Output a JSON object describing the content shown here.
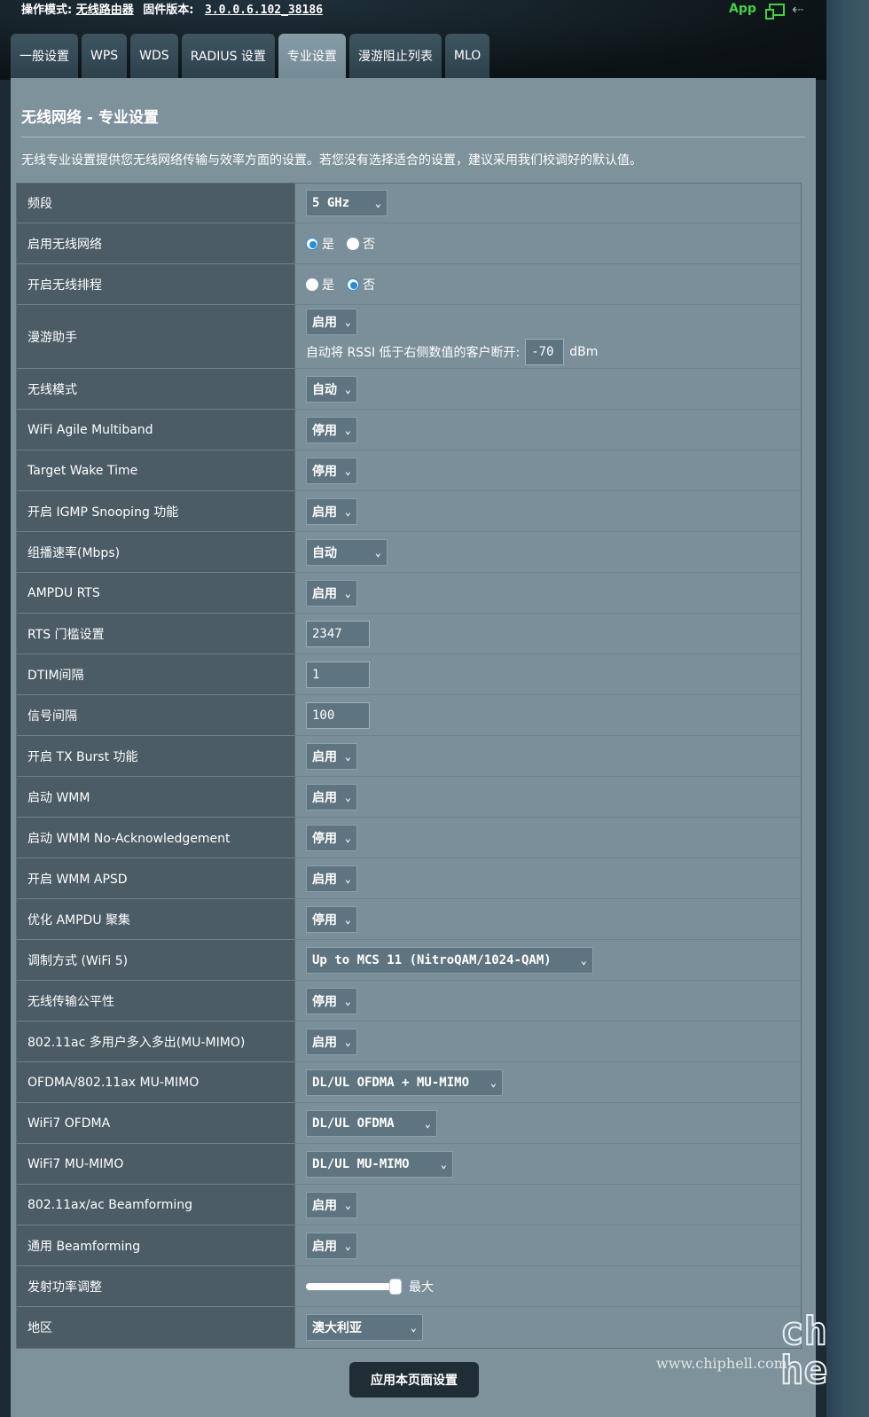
{
  "status": {
    "mode_label": "操作模式:",
    "mode_value": "无线路由器",
    "fw_label": "固件版本:",
    "fw_value": "3.0.0.6.102_38186",
    "app_label": "App"
  },
  "tabs": [
    {
      "label": "一般设置"
    },
    {
      "label": "WPS"
    },
    {
      "label": "WDS"
    },
    {
      "label": "RADIUS 设置"
    },
    {
      "label": "专业设置"
    },
    {
      "label": "漫游阻止列表"
    },
    {
      "label": "MLO"
    }
  ],
  "page": {
    "title": "无线网络 - 专业设置",
    "description": "无线专业设置提供您无线网络传输与效率方面的设置。若您没有选择适合的设置，建议采用我们校调好的默认值。"
  },
  "rows": {
    "band": {
      "label": "频段",
      "value": "5 GHz"
    },
    "enable_radio": {
      "label": "启用无线网络",
      "opt_yes": "是",
      "opt_no": "否",
      "selected": "yes"
    },
    "radio_schedule": {
      "label": "开启无线排程",
      "opt_yes": "是",
      "opt_no": "否",
      "selected": "no"
    },
    "roaming": {
      "label": "漫游助手",
      "value": "启用",
      "rssi_text": "自动将 RSSI 低于右侧数值的客户断开:",
      "rssi_value": "-70",
      "rssi_unit": "dBm"
    },
    "wireless_mode": {
      "label": "无线模式",
      "value": "自动"
    },
    "agile_multiband": {
      "label": "WiFi Agile Multiband",
      "value": "停用"
    },
    "twt": {
      "label": "Target Wake Time",
      "value": "停用"
    },
    "igmp": {
      "label": "开启 IGMP Snooping 功能",
      "value": "启用"
    },
    "multicast_rate": {
      "label": "组播速率(Mbps)",
      "value": "自动"
    },
    "ampdu_rts": {
      "label": "AMPDU RTS",
      "value": "启用"
    },
    "rts_threshold": {
      "label": "RTS 门槛设置",
      "value": "2347"
    },
    "dtim": {
      "label": "DTIM间隔",
      "value": "1"
    },
    "beacon": {
      "label": "信号间隔",
      "value": "100"
    },
    "tx_burst": {
      "label": "开启 TX Burst 功能",
      "value": "启用"
    },
    "wmm": {
      "label": "启动 WMM",
      "value": "启用"
    },
    "wmm_noack": {
      "label": "启动 WMM No-Acknowledgement",
      "value": "停用"
    },
    "wmm_apsd": {
      "label": "开启 WMM APSD",
      "value": "启用"
    },
    "ampdu_agg": {
      "label": "优化 AMPDU 聚集",
      "value": "停用"
    },
    "modulation": {
      "label": "调制方式 (WiFi 5)",
      "value": "Up to MCS 11 (NitroQAM/1024-QAM)"
    },
    "airtime_fair": {
      "label": "无线传输公平性",
      "value": "停用"
    },
    "mu_mimo_ac": {
      "label": "802.11ac 多用户多入多出(MU-MIMO)",
      "value": "启用"
    },
    "ofdma_ax": {
      "label": "OFDMA/802.11ax MU-MIMO",
      "value": "DL/UL OFDMA + MU-MIMO"
    },
    "wifi7_ofdma": {
      "label": "WiFi7 OFDMA",
      "value": "DL/UL OFDMA"
    },
    "wifi7_mumimo": {
      "label": "WiFi7 MU-MIMO",
      "value": "DL/UL MU-MIMO"
    },
    "beamforming": {
      "label": "802.11ax/ac Beamforming",
      "value": "启用"
    },
    "universal_bf": {
      "label": "通用 Beamforming",
      "value": "启用"
    },
    "tx_power": {
      "label": "发射功率调整",
      "value_label": "最大",
      "level_percent": 100
    },
    "region": {
      "label": "地区",
      "value": "澳大利亚"
    }
  },
  "apply_label": "应用本页面设置",
  "watermark": {
    "site": "www.chiphell.com",
    "logo": "chip hell"
  }
}
